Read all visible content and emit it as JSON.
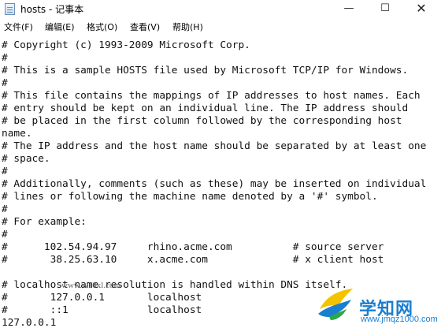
{
  "window": {
    "title": "hosts - 记事本",
    "minimize_glyph": "—",
    "maximize_glyph": "☐",
    "close_glyph": "✕"
  },
  "menu": [
    {
      "label": "文件(F)"
    },
    {
      "label": "编辑(E)"
    },
    {
      "label": "格式(O)"
    },
    {
      "label": "查看(V)"
    },
    {
      "label": "帮助(H)"
    }
  ],
  "editor": {
    "lines": [
      "# Copyright (c) 1993-2009 Microsoft Corp.",
      "#",
      "# This is a sample HOSTS file used by Microsoft TCP/IP for Windows.",
      "#",
      "# This file contains the mappings of IP addresses to host names. Each",
      "# entry should be kept on an individual line. The IP address should",
      "# be placed in the first column followed by the corresponding host",
      "name.",
      "# The IP address and the host name should be separated by at least one",
      "# space.",
      "#",
      "# Additionally, comments (such as these) may be inserted on individual",
      "# lines or following the machine name denoted by a '#' symbol.",
      "#",
      "# For example:",
      "#",
      "#      102.54.94.97     rhino.acme.com          # source server",
      "#       38.25.63.10     x.acme.com              # x client host",
      "",
      "# localhost name resolution is handled within DNS itself.",
      "#       127.0.0.1       localhost",
      "#       ::1             localhost",
      "127.0.0.1"
    ]
  },
  "watermark": {
    "site_text": "www.w10xl.com",
    "brand_name": "学知网",
    "brand_url": "www.jmqz1000.com",
    "brand_color": "#1a7fd1"
  }
}
